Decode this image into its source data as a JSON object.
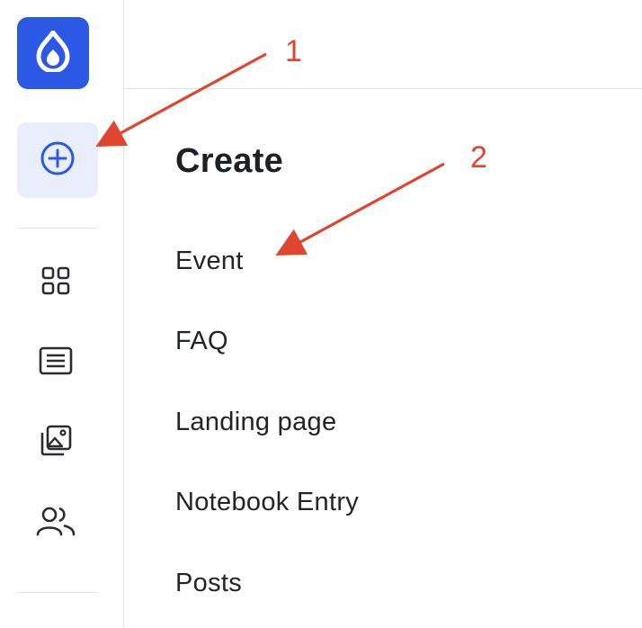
{
  "sidebar": {
    "logo_icon": "drupal-drop-icon",
    "create_icon": "plus-circle-icon",
    "nav_icons": [
      "dashboard-grid-icon",
      "content-list-icon",
      "media-image-icon",
      "people-icon"
    ]
  },
  "panel": {
    "title": "Create",
    "items": [
      {
        "label": "Event"
      },
      {
        "label": "FAQ"
      },
      {
        "label": "Landing page"
      },
      {
        "label": "Notebook Entry"
      },
      {
        "label": "Posts"
      }
    ]
  },
  "annotations": {
    "labels": [
      "1",
      "2"
    ],
    "color": "#e0452f"
  },
  "colors": {
    "brand": "#2b59e6",
    "active_bg": "#e9edfc"
  }
}
